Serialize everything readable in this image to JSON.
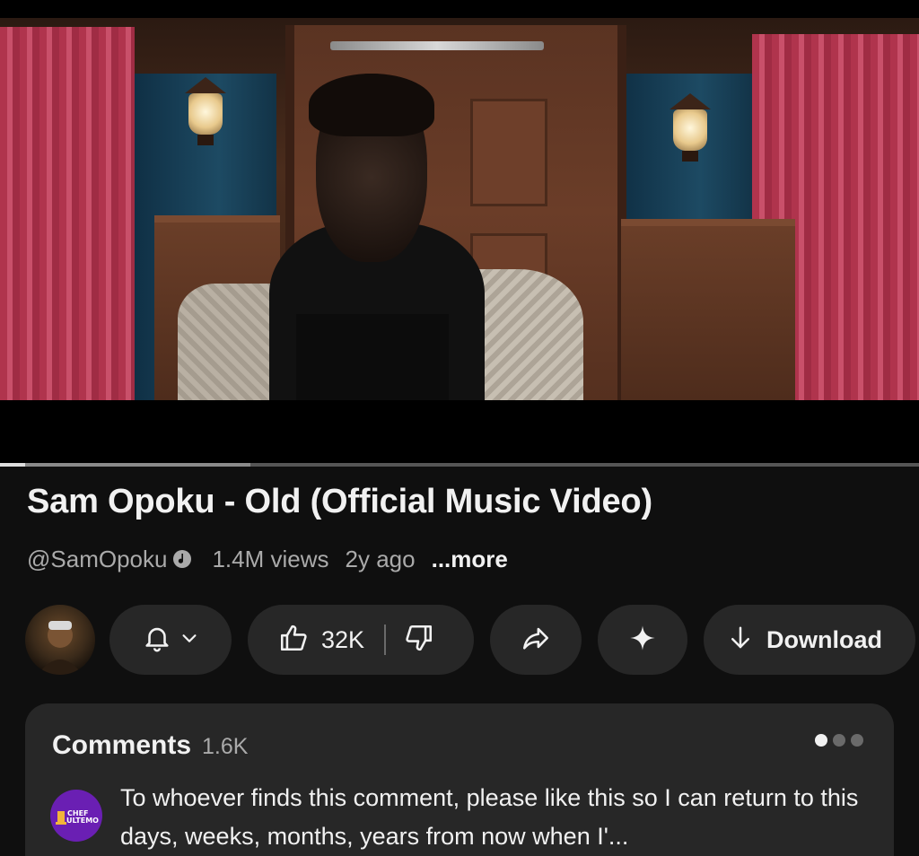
{
  "video": {
    "progress_fraction": 0.027,
    "buffer_fraction": 0.272
  },
  "title": "Sam Opoku - Old (Official Music Video)",
  "meta": {
    "channel_handle": "@SamOpoku",
    "views": "1.4M views",
    "age": "2y ago",
    "more_label": "...more"
  },
  "actions": {
    "like_count": "32K",
    "download_label": "Download",
    "icons": [
      "bell-icon",
      "chevron-down-icon",
      "thumbs-up-icon",
      "thumbs-down-icon",
      "share-icon",
      "sparkle-icon",
      "download-arrow-icon"
    ]
  },
  "comments": {
    "title": "Comments",
    "count": "1.6K",
    "page_dots": 3,
    "active_dot": 0,
    "commenter_avatar_text": "CHEF ULTEMO",
    "top_comment": "To whoever finds this comment, please like this so I can return to this days, weeks, months, years from now when I'..."
  },
  "colors": {
    "background": "#0f0f0f",
    "pill": "#272727",
    "secondary_text": "#aaaaaa",
    "commenter_avatar": "#6a1fb3"
  }
}
